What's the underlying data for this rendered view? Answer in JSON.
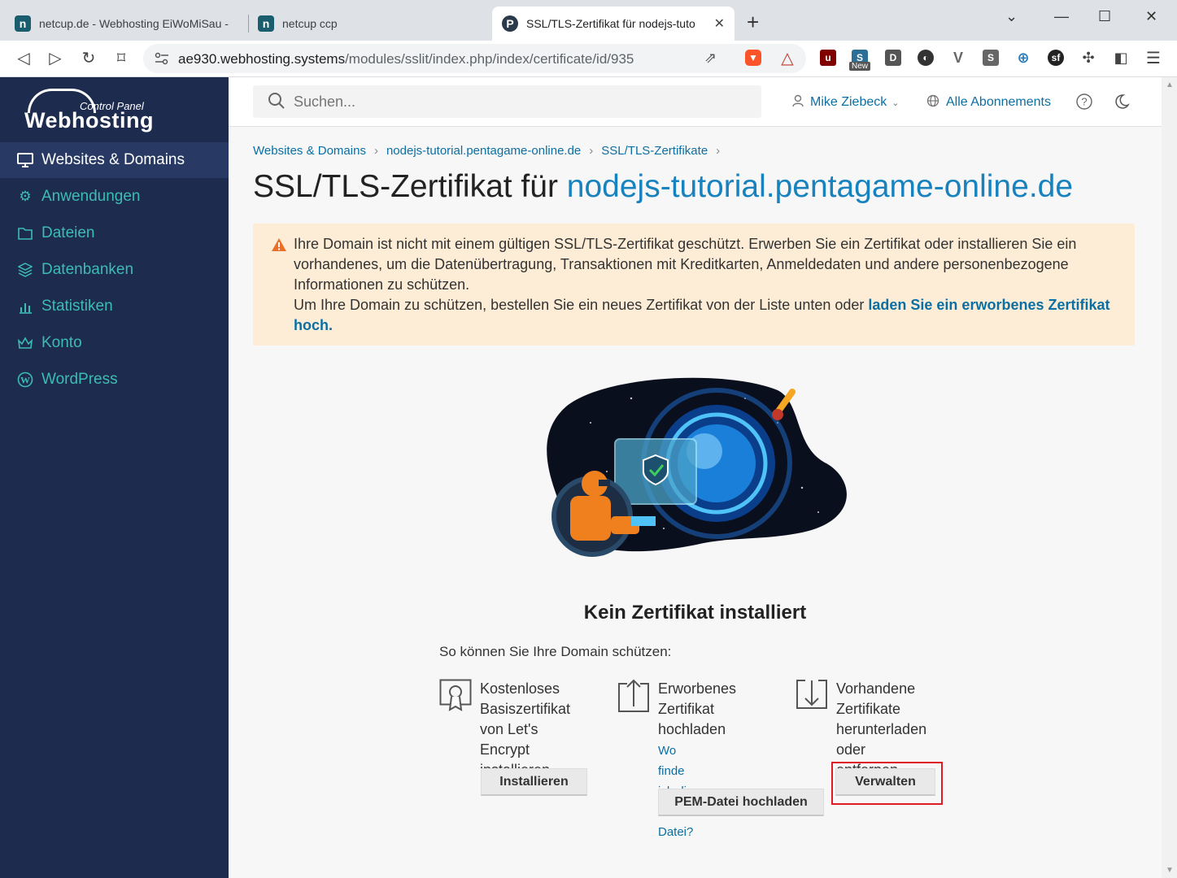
{
  "browser": {
    "tabs": [
      {
        "label": "netcup.de - Webhosting EiWoMiSau -",
        "icon": "netcup-n"
      },
      {
        "label": "netcup ccp",
        "icon": "netcup-n"
      },
      {
        "label": "SSL/TLS-Zertifikat für nodejs-tuto",
        "icon": "pentagame-p",
        "active": true
      }
    ],
    "new_tab": "+",
    "url_host": "ae930.webhosting.systems",
    "url_path": "/modules/sslit/index.php/index/certificate/id/935",
    "extension_new_badge": "New"
  },
  "sidebar": {
    "logo_top": "Control Panel",
    "logo_main": "Webhosting",
    "items": [
      {
        "label": "Websites & Domains",
        "icon": "monitor-icon",
        "active": true
      },
      {
        "label": "Anwendungen",
        "icon": "gear-icon"
      },
      {
        "label": "Dateien",
        "icon": "folder-icon"
      },
      {
        "label": "Datenbanken",
        "icon": "database-icon"
      },
      {
        "label": "Statistiken",
        "icon": "chart-icon"
      },
      {
        "label": "Konto",
        "icon": "crown-icon"
      },
      {
        "label": "WordPress",
        "icon": "wordpress-icon"
      }
    ]
  },
  "topbar": {
    "search_placeholder": "Suchen...",
    "user": "Mike Ziebeck",
    "subscriptions": "Alle Abonnements"
  },
  "breadcrumbs": [
    "Websites & Domains",
    "nodejs-tutorial.pentagame-online.de",
    "SSL/TLS-Zertifikate"
  ],
  "page": {
    "title_prefix": "SSL/TLS-Zertifikat für ",
    "title_domain": "nodejs-tutorial.pentagame-online.de"
  },
  "alert": {
    "text1": "Ihre Domain ist nicht mit einem gültigen SSL/TLS-Zertifikat geschützt. Erwerben Sie ein Zertifikat oder installieren Sie ein vorhandenes, um die Datenübertragung, Transaktionen mit Kreditkarten, Anmeldedaten und andere personenbezogene Informationen zu schützen.",
    "text2": "Um Ihre Domain zu schützen, bestellen Sie ein neues Zertifikat von der Liste unten oder ",
    "link": "laden Sie ein erworbenes Zertifikat hoch."
  },
  "empty": {
    "title": "Kein Zertifikat installiert",
    "subtitle": "So können Sie Ihre Domain schützen:"
  },
  "options": [
    {
      "lines": [
        "Kostenloses",
        "Basiszertifikat",
        "von Let's Encrypt",
        "installieren"
      ],
      "button": "Installieren",
      "icon": "certificate-icon"
    },
    {
      "lines": [
        "Erworbenes",
        "Zertifikat",
        "hochladen"
      ],
      "link_lines": [
        "Wo finde ich die",
        "PEM-Datei?"
      ],
      "button": "PEM-Datei hochladen",
      "icon": "upload-icon"
    },
    {
      "lines": [
        "Vorhandene",
        "Zertifikate",
        "herunterladen",
        "oder entfernen"
      ],
      "button": "Verwalten",
      "icon": "download-icon"
    }
  ]
}
